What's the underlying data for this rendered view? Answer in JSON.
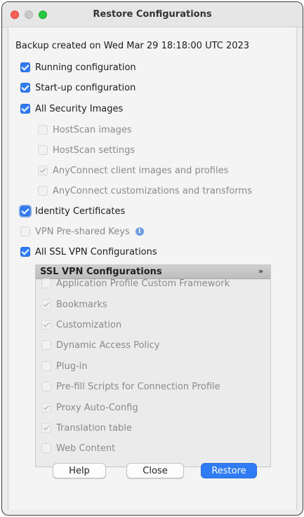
{
  "window": {
    "title": "Restore Configurations"
  },
  "backup_info": "Backup created on Wed Mar 29 18:18:00 UTC 2023",
  "options": {
    "running_configuration": {
      "label": "Running configuration",
      "checked": true
    },
    "startup_configuration": {
      "label": "Start-up configuration",
      "checked": true
    },
    "all_security_images": {
      "label": "All Security Images",
      "checked": true
    },
    "hostscan_images": {
      "label": "HostScan images",
      "checked": false,
      "enabled": false
    },
    "hostscan_settings": {
      "label": "HostScan settings",
      "checked": false,
      "enabled": false
    },
    "anyconnect_images": {
      "label": "AnyConnect client images and profiles",
      "checked": true,
      "enabled": false
    },
    "anyconnect_customizations": {
      "label": "AnyConnect customizations and transforms",
      "checked": false,
      "enabled": false
    },
    "identity_certificates": {
      "label": "Identity Certificates",
      "checked": true
    },
    "vpn_preshared_keys": {
      "label": "VPN Pre-shared Keys",
      "checked": false,
      "enabled": false
    },
    "all_ssl_vpn": {
      "label": "All SSL VPN Configurations",
      "checked": true
    }
  },
  "ssl_panel": {
    "title": "SSL VPN Configurations",
    "items": [
      {
        "label": "Application Profile Custom Framework",
        "checked": false
      },
      {
        "label": "Bookmarks",
        "checked": true
      },
      {
        "label": "Customization",
        "checked": true
      },
      {
        "label": "Dynamic Access Policy",
        "checked": false
      },
      {
        "label": "Plug-in",
        "checked": false
      },
      {
        "label": "Pre-fill Scripts for Connection Profile",
        "checked": false
      },
      {
        "label": "Proxy Auto-Config",
        "checked": true
      },
      {
        "label": "Translation table",
        "checked": true
      },
      {
        "label": "Web Content",
        "checked": false
      }
    ]
  },
  "buttons": {
    "help": "Help",
    "close": "Close",
    "restore": "Restore"
  },
  "colors": {
    "accent": "#2f7cf6",
    "close_light": "#fe5f57",
    "zoom_light": "#28c840"
  }
}
